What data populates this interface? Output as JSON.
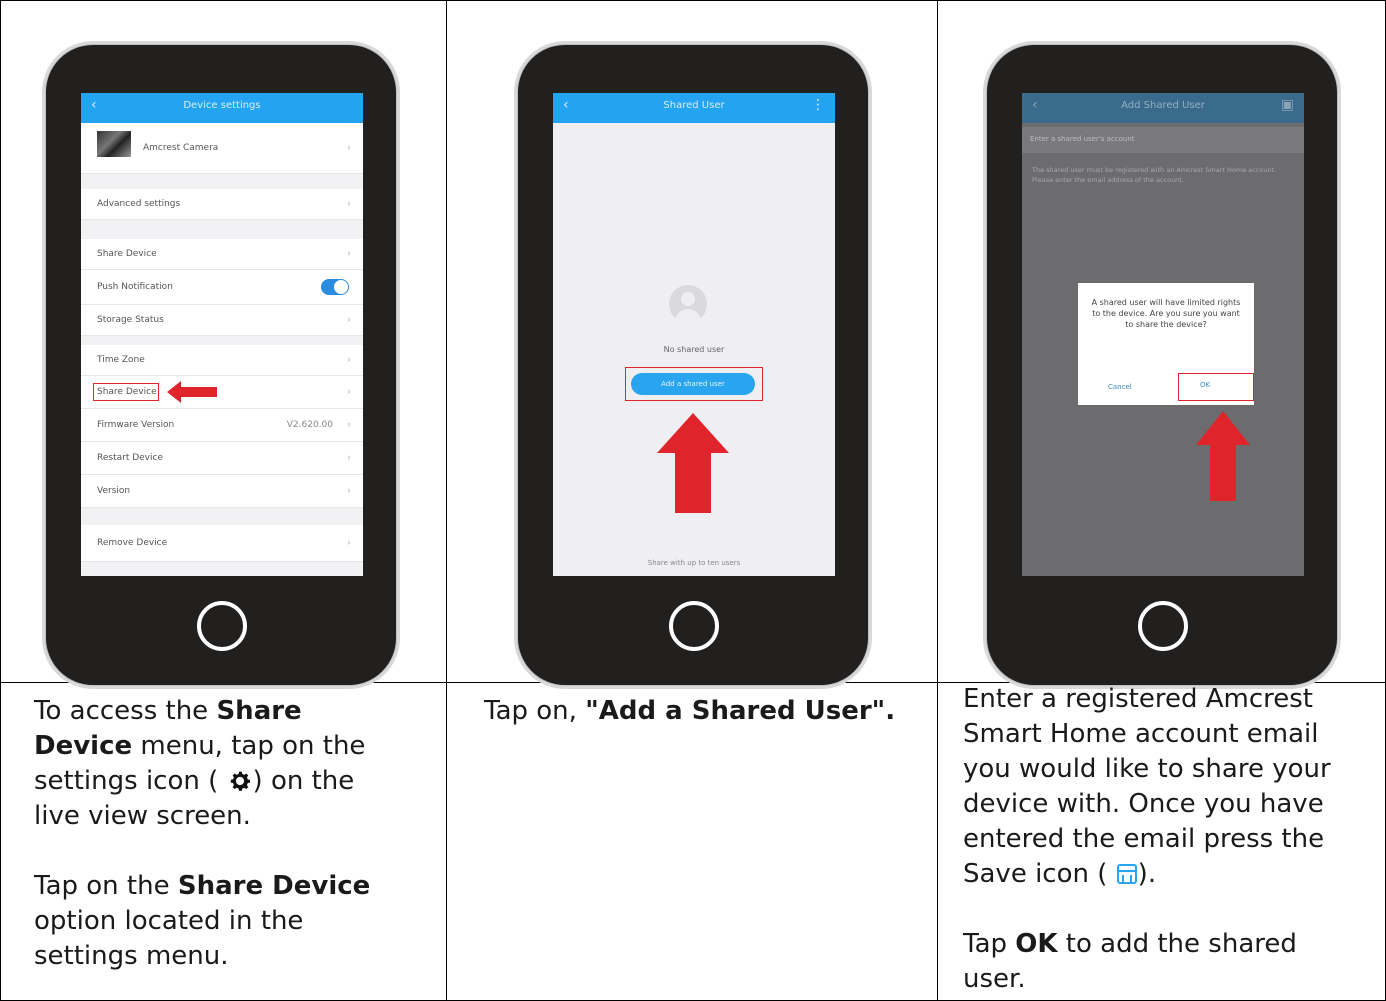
{
  "panel1": {
    "screen_title": "Device settings",
    "device_name": "Amcrest Camera",
    "rows": [
      {
        "label": "Advanced settings"
      },
      {
        "label": "Share Device"
      },
      {
        "label": "Push Notification"
      },
      {
        "label": "Storage Status"
      },
      {
        "label": "Time Zone"
      },
      {
        "label": "Share Device"
      },
      {
        "label": "Firmware Version",
        "value": "V2.620.00"
      },
      {
        "label": "Restart Device"
      },
      {
        "label": "Version"
      },
      {
        "label": "Remove Device"
      }
    ],
    "caption": {
      "p1_a": "To access the ",
      "p1_b": "Share",
      "p1_c": "Device",
      "p1_d": " menu, tap on the",
      "p1_e": "settings icon (",
      "p1_f": ") on the",
      "p1_g": "live view screen.",
      "p2_a": "Tap on the ",
      "p2_b": "Share Device",
      "p2_c": "option located in the",
      "p2_d": "settings menu."
    }
  },
  "panel2": {
    "screen_title": "Shared User",
    "no_user_text": "No shared user",
    "add_button": "Add a shared user",
    "bottom_note": "Share with up to ten users",
    "caption": {
      "a": "Tap on, ",
      "b": "\"Add a Shared User\"."
    }
  },
  "panel3": {
    "screen_title": "Add Shared User",
    "field_label": "Enter a shared user's account",
    "hint": "The shared user must be registered with an Amcrest Smart Home account. Please enter the email address of the account.",
    "dialog_message": "A shared user will have limited rights to the device. Are you sure you want to share the device?",
    "dialog_cancel": "Cancel",
    "dialog_ok": "OK",
    "caption": {
      "l1": "Enter a registered Amcrest",
      "l2": "Smart Home account email",
      "l3": "you would like to share your",
      "l4": "device with. Once you have",
      "l5": "entered the email press the",
      "l6a": "Save icon (",
      "l6b": ").",
      "p2_a": "Tap ",
      "p2_b": "OK",
      "p2_c": " to add the shared",
      "p2_d": "user."
    }
  },
  "colors": {
    "app_blue": "#24a4f0",
    "arrow_red": "#e0242b",
    "phone_body": "#221f1f"
  }
}
